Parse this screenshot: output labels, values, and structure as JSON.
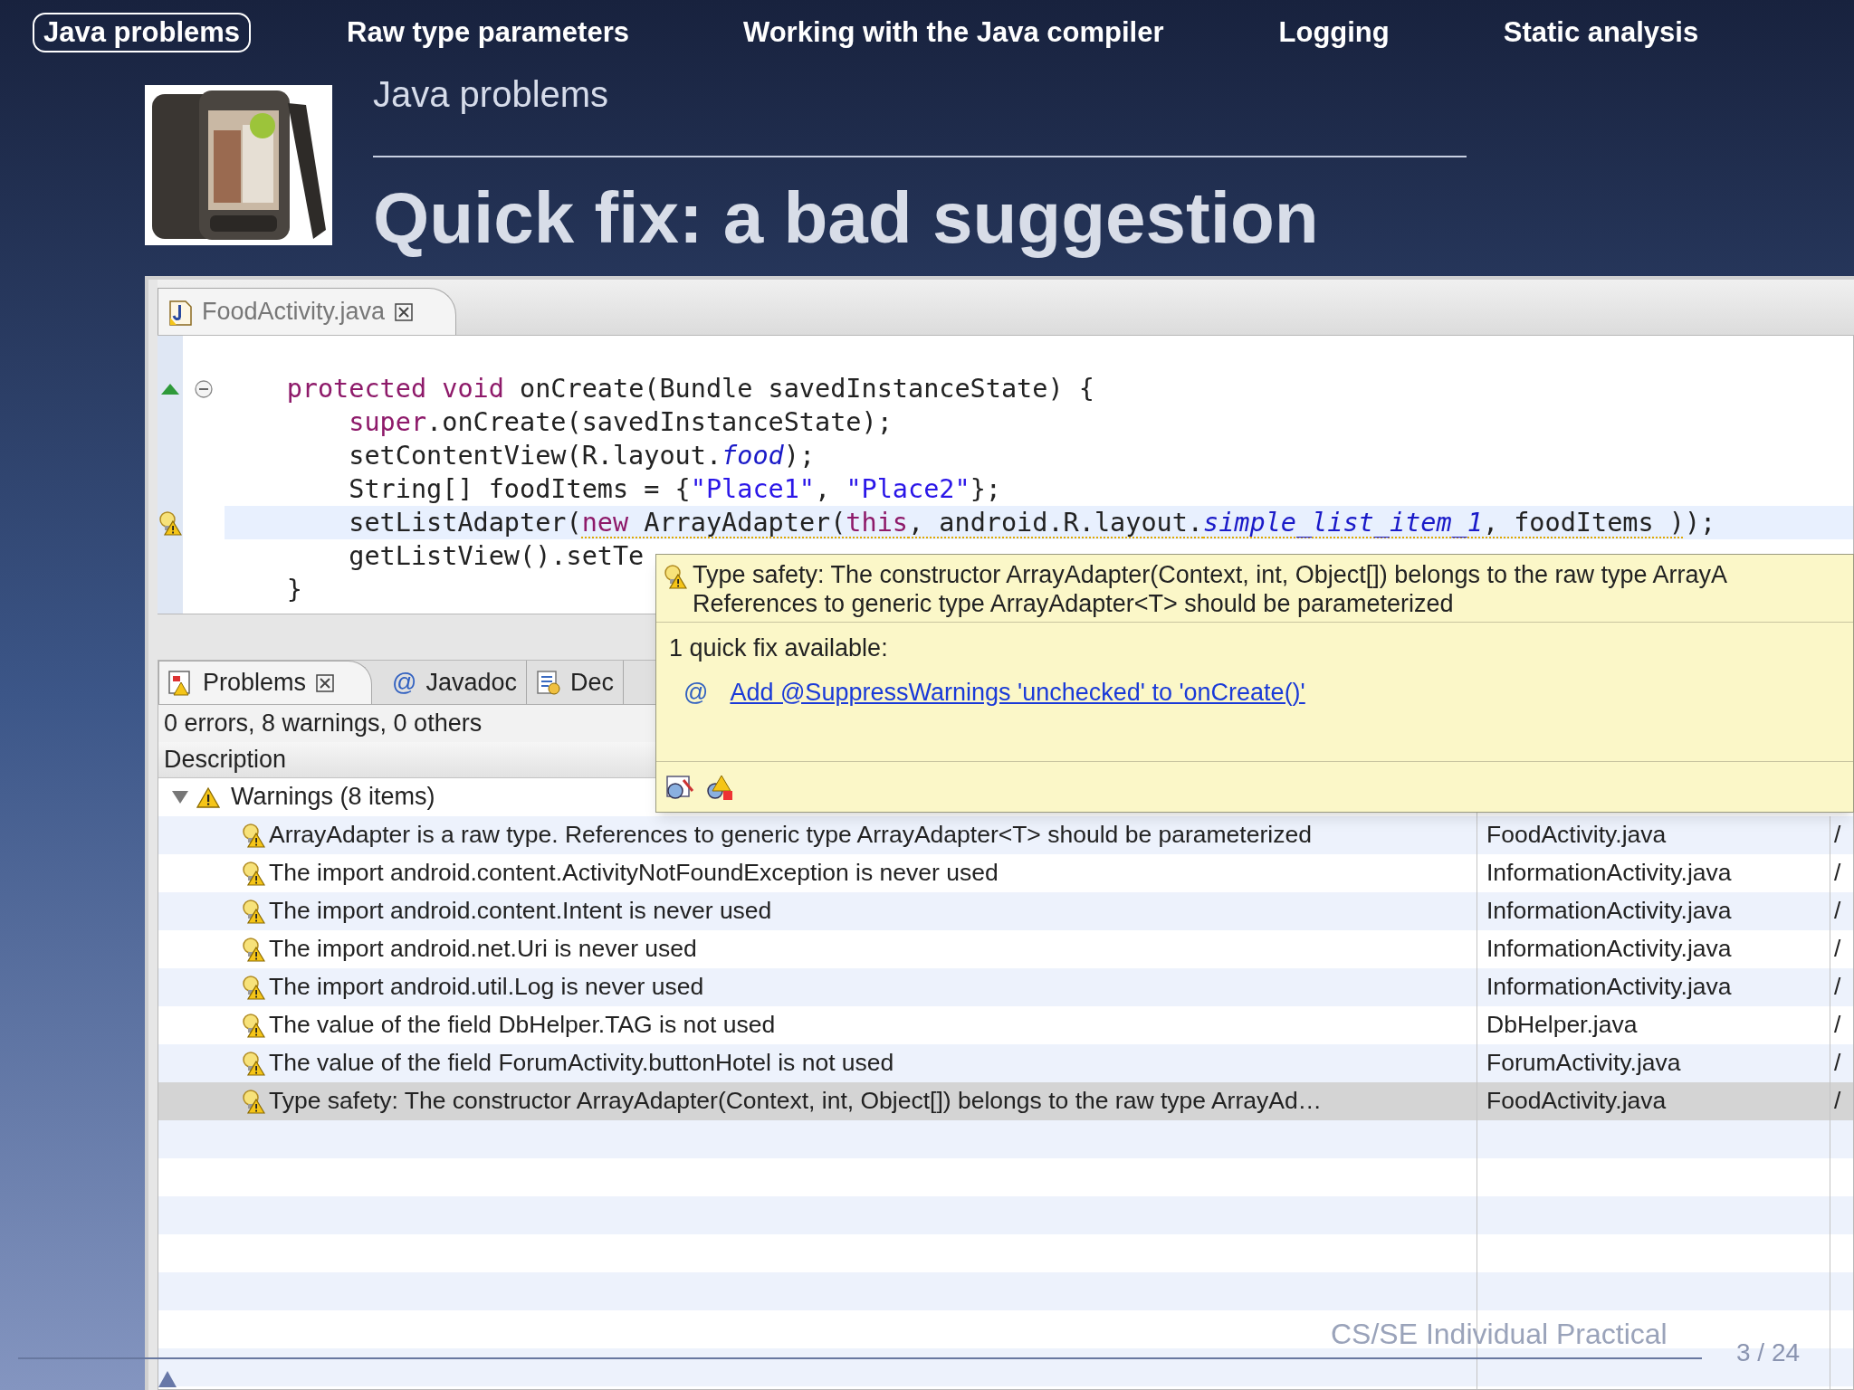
{
  "nav": [
    {
      "label": "Java problems",
      "selected": true
    },
    {
      "label": "Raw type parameters",
      "selected": false
    },
    {
      "label": "Working with the Java compiler",
      "selected": false
    },
    {
      "label": "Logging",
      "selected": false
    },
    {
      "label": "Static analysis",
      "selected": false
    }
  ],
  "subtitle": "Java problems",
  "title": "Quick fix: a bad suggestion",
  "editor": {
    "tab": "FoodActivity.java",
    "lines": [
      {
        "kind": "override",
        "fold": true,
        "current": false,
        "segments": [
          {
            "text": "    protected void",
            "kind": "keyword",
            "underlined": false
          },
          {
            "text": " onCreate(Bundle savedInstanceState) {",
            "kind": "plain",
            "underlined": false
          }
        ]
      },
      {
        "kind": "plain",
        "fold": false,
        "current": false,
        "segments": [
          {
            "text": "        super",
            "kind": "keyword",
            "underlined": false
          },
          {
            "text": ".onCreate(savedInstanceState);",
            "kind": "plain",
            "underlined": false
          }
        ]
      },
      {
        "kind": "plain",
        "fold": false,
        "current": false,
        "segments": [
          {
            "text": "        setContentView(R.layout.",
            "kind": "plain",
            "underlined": false
          },
          {
            "text": "food",
            "kind": "field",
            "underlined": false
          },
          {
            "text": ");",
            "kind": "plain",
            "underlined": false
          }
        ]
      },
      {
        "kind": "plain",
        "fold": false,
        "current": false,
        "segments": [
          {
            "text": "        String[] foodItems = {",
            "kind": "plain",
            "underlined": false
          },
          {
            "text": "\"Place1\"",
            "kind": "string",
            "underlined": false
          },
          {
            "text": ", ",
            "kind": "plain",
            "underlined": false
          },
          {
            "text": "\"Place2\"",
            "kind": "string",
            "underlined": false
          },
          {
            "text": "};",
            "kind": "plain",
            "underlined": false
          }
        ]
      },
      {
        "kind": "warning",
        "fold": false,
        "current": true,
        "segments": [
          {
            "text": "        setListAdapter(",
            "kind": "plain",
            "underlined": false
          },
          {
            "text": "new",
            "kind": "keyword",
            "underlined": true
          },
          {
            "text": " ArrayAdapter(",
            "kind": "plain",
            "underlined": true
          },
          {
            "text": "this",
            "kind": "keyword",
            "underlined": true
          },
          {
            "text": ", android.R.layout.",
            "kind": "plain",
            "underlined": true
          },
          {
            "text": "simple_list_item_1",
            "kind": "field",
            "underlined": true
          },
          {
            "text": ", foodItems )",
            "kind": "plain",
            "underlined": true
          },
          {
            "text": ");",
            "kind": "plain",
            "underlined": false
          }
        ]
      },
      {
        "kind": "plain",
        "fold": false,
        "current": false,
        "segments": [
          {
            "text": "        getListView().setTe",
            "kind": "plain",
            "underlined": false
          }
        ]
      },
      {
        "kind": "plain",
        "fold": false,
        "current": false,
        "segments": [
          {
            "text": "    }",
            "kind": "plain",
            "underlined": false
          }
        ]
      }
    ]
  },
  "problems": {
    "tabs": [
      {
        "label": "Problems",
        "kind": "problems",
        "selected": true,
        "closable": true
      },
      {
        "label": "Javadoc",
        "kind": "javadoc",
        "icon": "@",
        "selected": false,
        "closable": false
      },
      {
        "label": "Dec",
        "kind": "declaration",
        "selected": false,
        "closable": false
      }
    ],
    "summary": "0 errors, 8 warnings, 0 others",
    "columns": [
      "Description"
    ],
    "groups": [
      {
        "label": "Warnings (8 items)",
        "expanded": true,
        "children": [
          {
            "description": "ArrayAdapter is a raw type. References to generic type ArrayAdapter<T> should be parameterized",
            "resource": "FoodActivity.java",
            "path": "/",
            "selected": false
          },
          {
            "description": "The import android.content.ActivityNotFoundException is never used",
            "resource": "InformationActivity.java",
            "path": "/",
            "selected": false
          },
          {
            "description": "The import android.content.Intent is never used",
            "resource": "InformationActivity.java",
            "path": "/",
            "selected": false
          },
          {
            "description": "The import android.net.Uri is never used",
            "resource": "InformationActivity.java",
            "path": "/",
            "selected": false
          },
          {
            "description": "The import android.util.Log is never used",
            "resource": "InformationActivity.java",
            "path": "/",
            "selected": false
          },
          {
            "description": "The value of the field DbHelper.TAG is not used",
            "resource": "DbHelper.java",
            "path": "/",
            "selected": false
          },
          {
            "description": "The value of the field ForumActivity.buttonHotel is not used",
            "resource": "ForumActivity.java",
            "path": "/",
            "selected": false
          },
          {
            "description": "Type safety: The constructor ArrayAdapter(Context, int, Object[]) belongs to the raw type ArrayAd…",
            "resource": "FoodActivity.java",
            "path": "/",
            "selected": true
          }
        ]
      }
    ]
  },
  "tooltip": {
    "message": [
      "Type safety: The constructor ArrayAdapter(Context, int, Object[]) belongs to the raw type ArrayA",
      "References to generic type ArrayAdapter<T> should be parameterized"
    ],
    "fix_count": "1 quick fix available:",
    "fixes": [
      {
        "icon": "@",
        "label": "Add @SuppressWarnings 'unchecked' to 'onCreate()'"
      }
    ]
  },
  "footer": {
    "course": "CS/SE Individual Practical",
    "page": "3 / 24"
  }
}
